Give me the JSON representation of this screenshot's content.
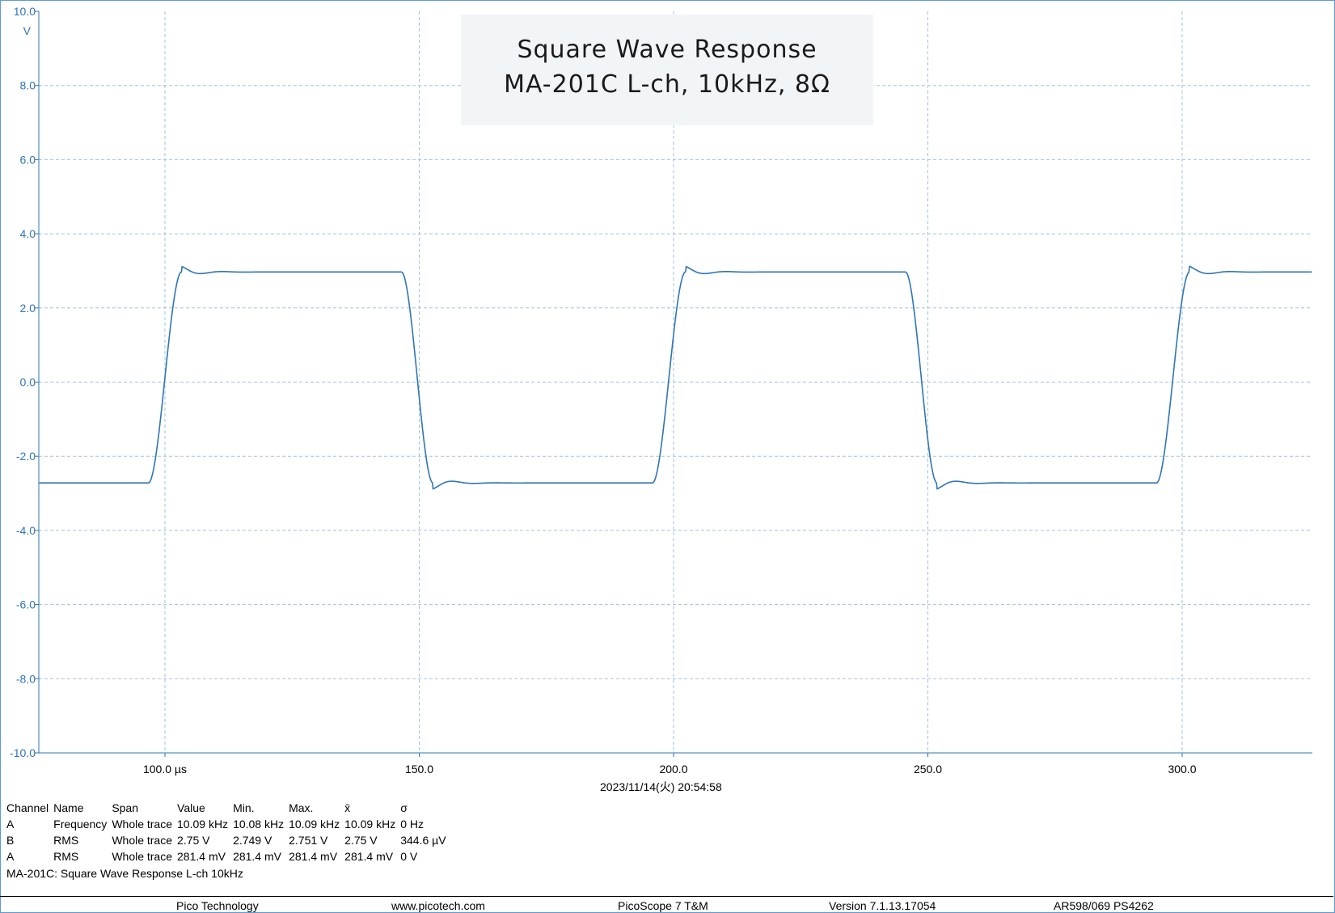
{
  "chart_data": {
    "type": "line",
    "title": "Square Wave Response",
    "subtitle": "MA-201C L-ch, 10kHz, 8Ω",
    "ylabel_unit": "V",
    "ylim": [
      -10.0,
      10.0
    ],
    "yticks": [
      "10.0",
      "8.0",
      "6.0",
      "4.0",
      "2.0",
      "0.0",
      "-2.0",
      "-4.0",
      "-6.0",
      "-8.0",
      "-10.0"
    ],
    "xlim_us": [
      75.2,
      325.6
    ],
    "xtick_values": [
      100,
      150,
      200,
      250,
      300
    ],
    "xticks": [
      "100.0 µs",
      "150.0",
      "200.0",
      "250.0",
      "300.0"
    ],
    "grid": true,
    "series": [
      {
        "color": "#2e75b6",
        "period_us": 99.1,
        "high_v": 2.97,
        "low_v": -2.72,
        "rising_edges_us": [
          100.0,
          199.1,
          298.2
        ],
        "falling_edges_us": [
          149.6,
          248.7
        ],
        "overshoot_peak_v": 3.12,
        "undershoot_peak_v": -2.88
      }
    ]
  },
  "timestamp": "2023/11/14(火) 20:54:58",
  "measurements": {
    "headers": [
      "Channel",
      "Name",
      "Span",
      "Value",
      "Min.",
      "Max.",
      "x̄",
      "σ"
    ],
    "rows": [
      [
        "A",
        "Frequency",
        "Whole trace",
        "10.09 kHz",
        "10.08 kHz",
        "10.09 kHz",
        "10.09 kHz",
        "0 Hz"
      ],
      [
        "B",
        "RMS",
        "Whole trace",
        "2.75 V",
        "2.749 V",
        "2.751 V",
        "2.75 V",
        "344.6 µV"
      ],
      [
        "A",
        "RMS",
        "Whole trace",
        "281.4 mV",
        "281.4 mV",
        "281.4 mV",
        "281.4 mV",
        "0 V"
      ]
    ]
  },
  "note": "MA-201C: Square Wave Response L-ch 10kHz",
  "footer": {
    "company": "Pico Technology",
    "website": "www.picotech.com",
    "product": "PicoScope 7 T&M",
    "version": "Version 7.1.13.17054",
    "device": "AR598/069 PS4262"
  }
}
